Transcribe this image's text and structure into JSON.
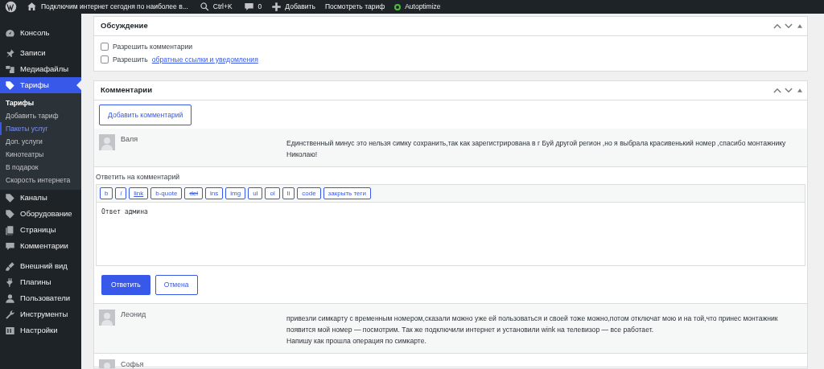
{
  "admin_bar": {
    "items": [
      {
        "kind": "logo"
      },
      {
        "kind": "home",
        "label": "Подключим интернет сегодня по наиболее в..."
      },
      {
        "kind": "search",
        "label": "Ctrl+K"
      },
      {
        "kind": "comments",
        "label": "0"
      },
      {
        "kind": "add",
        "label": "Добавить"
      },
      {
        "kind": "text",
        "label": "Посмотреть тариф"
      },
      {
        "kind": "status",
        "label": "Autoptimize"
      }
    ]
  },
  "sidebar": {
    "groups": [
      {
        "items": [
          {
            "kind": "dashboard",
            "label": "Консоль",
            "selected": false
          }
        ]
      },
      {
        "items": [
          {
            "kind": "pin",
            "label": "Записи",
            "selected": false
          },
          {
            "kind": "media",
            "label": "Медиафайлы",
            "selected": false
          },
          {
            "kind": "tag",
            "label": "Тарифы",
            "selected": true,
            "children": [
              {
                "label": "Тарифы",
                "kind": "head",
                "selected": false
              },
              {
                "label": "Добавить тариф",
                "kind": "link",
                "selected": false
              },
              {
                "label": "Пакеты услуг",
                "kind": "link",
                "selected": true
              },
              {
                "label": "Доп. услуги",
                "kind": "link",
                "selected": false
              },
              {
                "label": "Кинотеатры",
                "kind": "link",
                "selected": false
              },
              {
                "label": "В подарок",
                "kind": "link",
                "selected": false
              },
              {
                "label": "Скорость интернета",
                "kind": "link",
                "selected": false
              }
            ]
          },
          {
            "kind": "tag",
            "label": "Каналы",
            "selected": false
          },
          {
            "kind": "tag",
            "label": "Оборудование",
            "selected": false
          },
          {
            "kind": "pages",
            "label": "Страницы",
            "selected": false
          },
          {
            "kind": "comment",
            "label": "Комментарии",
            "selected": false
          }
        ]
      },
      {
        "items": [
          {
            "kind": "brush",
            "label": "Внешний вид",
            "selected": false
          },
          {
            "kind": "plugin",
            "label": "Плагины",
            "selected": false
          },
          {
            "kind": "user",
            "label": "Пользователи",
            "selected": false
          },
          {
            "kind": "wrench",
            "label": "Инструменты",
            "selected": false
          },
          {
            "kind": "settings",
            "label": "Настройки",
            "selected": false
          }
        ]
      }
    ]
  },
  "discussion": {
    "title": "Обсуждение",
    "options": [
      {
        "label": "Разрешить комментарии",
        "checked": false
      },
      {
        "label": "Разрешить",
        "link": "обратные ссылки и уведомления",
        "checked": false
      }
    ]
  },
  "comments_panel": {
    "title": "Комментарии",
    "add_button": "Добавить комментарий",
    "comments": [
      {
        "author": "Валя",
        "lines": [
          "Единственный минус это нельзя симку сохранить,так как зарегистрирована в г Буй другой регион ,но я выбрала красивенький номер ,спасибо монтажнику Николаю!"
        ],
        "shaded": true
      },
      {
        "author": "Леонид",
        "lines": [
          "привезли симкарту с временным номером,сказали можно уже ей пользоваться и своей тоже можно,потом отключат мою и на той,что принес монтажник появится мой номер — посмотрим. Так же подключили интернет и установили wink на телевизор — все работает.",
          "Напишу как прошла операция по симкарте."
        ],
        "shaded": true
      },
      {
        "author": "Софья",
        "shaded": false
      }
    ],
    "reply_form": {
      "title": "Ответить на комментарий",
      "value": "Ответ админа",
      "quicktags": [
        {
          "label": "b",
          "kind": "plain"
        },
        {
          "label": "i",
          "kind": "italic"
        },
        {
          "label": "link",
          "kind": "underline"
        },
        {
          "label": "b-quote",
          "kind": "plain"
        },
        {
          "label": "del",
          "kind": "strike"
        },
        {
          "label": "ins",
          "kind": "plain"
        },
        {
          "label": "img",
          "kind": "plain"
        },
        {
          "label": "ul",
          "kind": "plain"
        },
        {
          "label": "ol",
          "kind": "plain"
        },
        {
          "label": "li",
          "kind": "plain"
        },
        {
          "label": "code",
          "kind": "plain"
        },
        {
          "label": "закрыть теги",
          "kind": "plain"
        }
      ],
      "submit": "Ответить",
      "cancel": "Отмена"
    }
  }
}
